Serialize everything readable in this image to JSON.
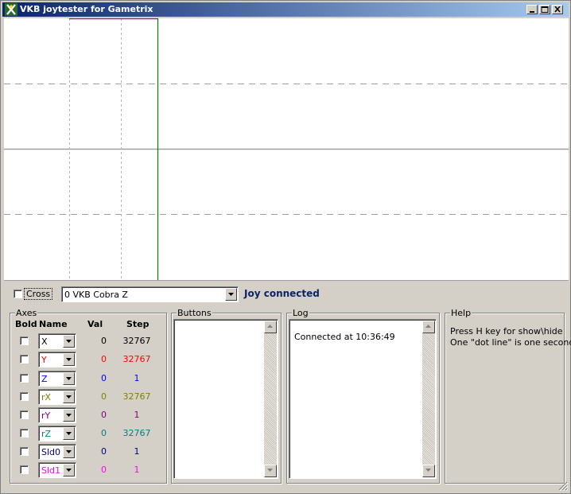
{
  "window": {
    "title": "VKB joytester for Gametrix",
    "app_icon": "gametrix-x-icon",
    "buttons": [
      "minimize-icon",
      "maximize-icon",
      "close-icon"
    ]
  },
  "plot": {
    "background": "#ffffff",
    "grid_color": "#a0a0a0",
    "series": [
      {
        "axis": "X",
        "color": "#000000"
      },
      {
        "axis": "Y",
        "color": "#ff0000"
      },
      {
        "axis": "Z",
        "color": "#0000ff"
      },
      {
        "axis": "rX",
        "color": "#808000"
      },
      {
        "axis": "rY",
        "color": "#800080"
      },
      {
        "axis": "rZ",
        "color": "#008080"
      },
      {
        "axis": "Sld0",
        "color": "#000080"
      },
      {
        "axis": "Sld1",
        "color": "#ff00ff"
      }
    ],
    "time_marker_color": "#008000"
  },
  "toolbar": {
    "cross_label": "Cross",
    "cross_checked": false,
    "device_selected": "0 VKB Cobra Z",
    "status": "Joy connected"
  },
  "axes": {
    "legend": "Axes",
    "headers": {
      "bold": "Bold",
      "name": "Name",
      "val": "Val",
      "step": "Step"
    },
    "rows": [
      {
        "name": "X",
        "val": "0",
        "step": "32767",
        "color": "#000000"
      },
      {
        "name": "Y",
        "val": "0",
        "step": "32767",
        "color": "#ff0000"
      },
      {
        "name": "Z",
        "val": "0",
        "step": "1",
        "color": "#0000ff"
      },
      {
        "name": "rX",
        "val": "0",
        "step": "32767",
        "color": "#808000"
      },
      {
        "name": "rY",
        "val": "0",
        "step": "1",
        "color": "#800080"
      },
      {
        "name": "rZ",
        "val": "0",
        "step": "32767",
        "color": "#008080"
      },
      {
        "name": "Sld0",
        "val": "0",
        "step": "1",
        "color": "#000080"
      },
      {
        "name": "Sld1",
        "val": "0",
        "step": "1",
        "color": "#ff00ff"
      }
    ]
  },
  "buttons_panel": {
    "legend": "Buttons"
  },
  "log_panel": {
    "legend": "Log",
    "lines": [
      "Connected at 10:36:49"
    ]
  },
  "help_panel": {
    "legend": "Help",
    "lines": [
      "Press H key for show\\hide",
      "One \"dot line\" is one second"
    ]
  }
}
